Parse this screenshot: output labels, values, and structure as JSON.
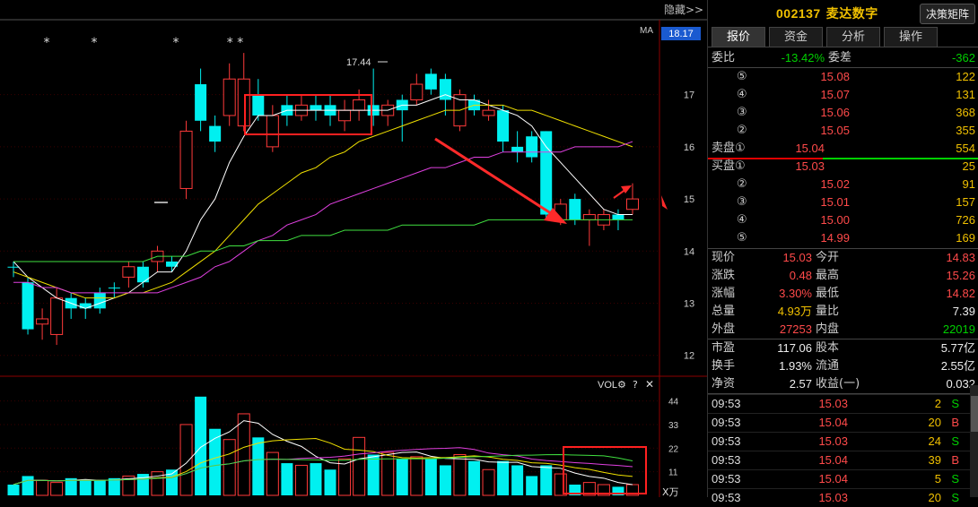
{
  "chart": {
    "hide_label": "隐藏>>",
    "ma_label": "MA",
    "price_tag": "18.17",
    "y_ticks": [
      "17",
      "16",
      "15",
      "14",
      "13",
      "12"
    ],
    "vol_label": "VOL",
    "vol_ticks": [
      "44",
      "33",
      "22",
      "11"
    ],
    "vol_unit": "X万",
    "high_annot": "17.44",
    "stars": [
      "*",
      "*",
      "*",
      "* *"
    ]
  },
  "chart_data": {
    "type": "candlestick",
    "price_ylim": [
      11.6,
      18.3
    ],
    "vol_ylim": [
      0,
      48
    ],
    "candles": [
      {
        "o": 13.7,
        "c": 13.7,
        "h": 13.8,
        "l": 13.5,
        "v": 5,
        "up": false
      },
      {
        "o": 13.4,
        "c": 12.5,
        "h": 13.5,
        "l": 12.4,
        "v": 9,
        "up": false
      },
      {
        "o": 12.6,
        "c": 12.7,
        "h": 12.9,
        "l": 12.3,
        "v": 7,
        "up": true
      },
      {
        "o": 13.1,
        "c": 12.4,
        "h": 13.3,
        "l": 12.2,
        "v": 6,
        "up": true
      },
      {
        "o": 13.1,
        "c": 12.9,
        "h": 13.2,
        "l": 12.7,
        "v": 8,
        "up": false
      },
      {
        "o": 13.0,
        "c": 12.9,
        "h": 13.1,
        "l": 12.7,
        "v": 7,
        "up": false
      },
      {
        "o": 13.2,
        "c": 12.9,
        "h": 13.3,
        "l": 12.8,
        "v": 7,
        "up": false
      },
      {
        "o": 13.3,
        "c": 13.3,
        "h": 13.4,
        "l": 13.1,
        "v": 8,
        "up": false
      },
      {
        "o": 13.5,
        "c": 13.7,
        "h": 13.8,
        "l": 13.3,
        "v": 9,
        "up": true
      },
      {
        "o": 13.7,
        "c": 13.4,
        "h": 13.8,
        "l": 13.3,
        "v": 10,
        "up": false
      },
      {
        "o": 13.8,
        "c": 14.0,
        "h": 14.1,
        "l": 13.6,
        "v": 11,
        "up": true
      },
      {
        "o": 13.8,
        "c": 13.7,
        "h": 13.9,
        "l": 13.6,
        "v": 12,
        "up": false
      },
      {
        "o": 15.2,
        "c": 16.3,
        "h": 16.5,
        "l": 15.0,
        "v": 33,
        "up": true
      },
      {
        "o": 17.2,
        "c": 16.5,
        "h": 17.5,
        "l": 16.3,
        "v": 46,
        "up": false
      },
      {
        "o": 16.4,
        "c": 16.1,
        "h": 16.6,
        "l": 15.9,
        "v": 31,
        "up": false
      },
      {
        "o": 16.6,
        "c": 17.3,
        "h": 17.6,
        "l": 16.4,
        "v": 26,
        "up": true
      },
      {
        "o": 17.3,
        "c": 16.4,
        "h": 17.8,
        "l": 16.3,
        "v": 38,
        "up": true
      },
      {
        "o": 16.6,
        "c": 17.0,
        "h": 17.3,
        "l": 16.5,
        "v": 27,
        "up": false
      },
      {
        "o": 16.6,
        "c": 16.0,
        "h": 16.8,
        "l": 15.9,
        "v": 20,
        "up": true
      },
      {
        "o": 16.6,
        "c": 16.8,
        "h": 17.0,
        "l": 16.4,
        "v": 15,
        "up": false
      },
      {
        "o": 16.8,
        "c": 16.6,
        "h": 17.0,
        "l": 16.5,
        "v": 14,
        "up": true
      },
      {
        "o": 16.7,
        "c": 16.8,
        "h": 17.0,
        "l": 16.5,
        "v": 15,
        "up": false
      },
      {
        "o": 16.8,
        "c": 16.6,
        "h": 17.0,
        "l": 16.4,
        "v": 12,
        "up": false
      },
      {
        "o": 16.5,
        "c": 16.7,
        "h": 16.9,
        "l": 16.3,
        "v": 17,
        "up": true
      },
      {
        "o": 16.7,
        "c": 16.9,
        "h": 17.1,
        "l": 16.5,
        "v": 27,
        "up": true
      },
      {
        "o": 16.8,
        "c": 16.6,
        "h": 17.5,
        "l": 16.4,
        "v": 19,
        "up": false
      },
      {
        "o": 16.8,
        "c": 16.6,
        "h": 16.9,
        "l": 16.4,
        "v": 20,
        "up": true
      },
      {
        "o": 16.7,
        "c": 16.9,
        "h": 17.0,
        "l": 16.1,
        "v": 17,
        "up": false
      },
      {
        "o": 16.9,
        "c": 17.2,
        "h": 17.4,
        "l": 16.8,
        "v": 18,
        "up": true
      },
      {
        "o": 17.4,
        "c": 17.1,
        "h": 17.5,
        "l": 17.0,
        "v": 17,
        "up": false
      },
      {
        "o": 17.3,
        "c": 16.9,
        "h": 17.4,
        "l": 16.6,
        "v": 14,
        "up": false
      },
      {
        "o": 17.0,
        "c": 16.4,
        "h": 17.1,
        "l": 16.3,
        "v": 19,
        "up": true
      },
      {
        "o": 16.7,
        "c": 16.9,
        "h": 17.0,
        "l": 16.6,
        "v": 16,
        "up": false
      },
      {
        "o": 16.7,
        "c": 16.6,
        "h": 16.9,
        "l": 16.5,
        "v": 12,
        "up": true
      },
      {
        "o": 16.7,
        "c": 16.1,
        "h": 16.8,
        "l": 15.9,
        "v": 16,
        "up": false
      },
      {
        "o": 16.0,
        "c": 15.9,
        "h": 16.3,
        "l": 15.7,
        "v": 14,
        "up": false
      },
      {
        "o": 15.8,
        "c": 16.2,
        "h": 16.3,
        "l": 15.7,
        "v": 9,
        "up": false
      },
      {
        "o": 16.3,
        "c": 14.7,
        "h": 16.3,
        "l": 14.6,
        "v": 14,
        "up": false
      },
      {
        "o": 14.9,
        "c": 14.6,
        "h": 15.0,
        "l": 14.5,
        "v": 10,
        "up": true
      },
      {
        "o": 15.0,
        "c": 14.6,
        "h": 15.1,
        "l": 14.5,
        "v": 5,
        "up": false
      },
      {
        "o": 14.6,
        "c": 14.7,
        "h": 14.8,
        "l": 14.1,
        "v": 6,
        "up": true
      },
      {
        "o": 14.5,
        "c": 14.7,
        "h": 14.8,
        "l": 14.4,
        "v": 5,
        "up": true
      },
      {
        "o": 14.7,
        "c": 14.6,
        "h": 14.8,
        "l": 14.4,
        "v": 4,
        "up": false
      },
      {
        "o": 14.8,
        "c": 15.0,
        "h": 15.3,
        "l": 14.7,
        "v": 5,
        "up": true
      }
    ],
    "ma_series": [
      {
        "color": "#ffffff",
        "values": [
          13.8,
          13.5,
          13.3,
          13.1,
          13.0,
          12.9,
          13.0,
          13.1,
          13.2,
          13.4,
          13.6,
          13.6,
          14.0,
          14.6,
          15.0,
          15.7,
          16.2,
          16.6,
          16.6,
          16.7,
          16.7,
          16.7,
          16.7,
          16.7,
          16.7,
          16.7,
          16.7,
          16.8,
          16.8,
          16.9,
          17.0,
          16.9,
          16.9,
          16.8,
          16.7,
          16.6,
          16.4,
          16.0,
          15.7,
          15.4,
          15.1,
          14.8,
          14.7,
          14.7
        ]
      },
      {
        "color": "#f0e000",
        "values": [
          13.6,
          13.5,
          13.4,
          13.3,
          13.2,
          13.1,
          13.1,
          13.1,
          13.2,
          13.2,
          13.3,
          13.4,
          13.6,
          13.8,
          14.0,
          14.3,
          14.6,
          14.9,
          15.1,
          15.3,
          15.5,
          15.6,
          15.8,
          15.9,
          16.1,
          16.2,
          16.3,
          16.4,
          16.5,
          16.6,
          16.7,
          16.7,
          16.8,
          16.8,
          16.8,
          16.7,
          16.7,
          16.6,
          16.5,
          16.4,
          16.3,
          16.2,
          16.1,
          16.0
        ]
      },
      {
        "color": "#e040e0",
        "values": [
          13.4,
          13.4,
          13.3,
          13.3,
          13.2,
          13.2,
          13.2,
          13.2,
          13.2,
          13.2,
          13.2,
          13.3,
          13.4,
          13.5,
          13.7,
          13.8,
          14.0,
          14.2,
          14.3,
          14.5,
          14.6,
          14.7,
          14.9,
          15.0,
          15.1,
          15.2,
          15.3,
          15.4,
          15.5,
          15.6,
          15.6,
          15.7,
          15.8,
          15.8,
          15.9,
          15.9,
          15.9,
          15.9,
          15.9,
          16.0,
          16.0,
          16.0,
          16.0,
          16.1
        ]
      },
      {
        "color": "#40e040",
        "values": [
          13.8,
          13.8,
          13.8,
          13.8,
          13.8,
          13.8,
          13.8,
          13.8,
          13.8,
          13.8,
          13.9,
          13.9,
          13.9,
          14.0,
          14.0,
          14.1,
          14.1,
          14.2,
          14.2,
          14.2,
          14.3,
          14.3,
          14.3,
          14.4,
          14.4,
          14.4,
          14.4,
          14.5,
          14.5,
          14.5,
          14.5,
          14.5,
          14.5,
          14.6,
          14.6,
          14.6,
          14.6,
          14.6,
          14.6,
          14.6,
          14.6,
          14.6,
          14.6,
          14.6
        ]
      }
    ]
  },
  "side": {
    "code": "002137",
    "name": "麦达数字",
    "matrix_btn": "决策矩阵",
    "tabs": [
      "报价",
      "资金",
      "分析",
      "操作"
    ],
    "weibi_label": "委比",
    "weibi_val": "-13.42%",
    "weicha_label": "委差",
    "weicha_val": "-362",
    "asks": [
      {
        "label": "⑤",
        "price": "15.08",
        "vol": "122"
      },
      {
        "label": "④",
        "price": "15.07",
        "vol": "131"
      },
      {
        "label": "③",
        "price": "15.06",
        "vol": "368"
      },
      {
        "label": "②",
        "price": "15.05",
        "vol": "355"
      },
      {
        "label": "卖盘①",
        "price": "15.04",
        "vol": "554"
      }
    ],
    "bids": [
      {
        "label": "买盘①",
        "price": "15.03",
        "vol": "25"
      },
      {
        "label": "②",
        "price": "15.02",
        "vol": "91"
      },
      {
        "label": "③",
        "price": "15.01",
        "vol": "157"
      },
      {
        "label": "④",
        "price": "15.00",
        "vol": "726"
      },
      {
        "label": "⑤",
        "price": "14.99",
        "vol": "169"
      }
    ],
    "stats": [
      {
        "a": "现价",
        "b": "15.03",
        "bc": "red",
        "c": "今开",
        "d": "14.83",
        "dc": "red"
      },
      {
        "a": "涨跌",
        "b": "0.48",
        "bc": "red",
        "c": "最高",
        "d": "15.26",
        "dc": "red"
      },
      {
        "a": "涨幅",
        "b": "3.30%",
        "bc": "red",
        "c": "最低",
        "d": "14.82",
        "dc": "red"
      },
      {
        "a": "总量",
        "b": "4.93万",
        "bc": "yellow",
        "c": "量比",
        "d": "7.39",
        "dc": "white"
      },
      {
        "a": "外盘",
        "b": "27253",
        "bc": "red",
        "c": "内盘",
        "d": "22019",
        "dc": "green"
      }
    ],
    "stats2": [
      {
        "a": "市盈",
        "b": "117.06",
        "c": "股本",
        "d": "5.77亿"
      },
      {
        "a": "换手",
        "b": "1.93%",
        "c": "流通",
        "d": "2.55亿"
      },
      {
        "a": "净资",
        "b": "2.57",
        "c": "收益(一)",
        "d": "0.032"
      }
    ],
    "ticks": [
      {
        "t": "09:53",
        "p": "15.03",
        "v": "2",
        "bs": "S"
      },
      {
        "t": "09:53",
        "p": "15.04",
        "v": "20",
        "bs": "B"
      },
      {
        "t": "09:53",
        "p": "15.03",
        "v": "24",
        "bs": "S"
      },
      {
        "t": "09:53",
        "p": "15.04",
        "v": "39",
        "bs": "B"
      },
      {
        "t": "09:53",
        "p": "15.04",
        "v": "5",
        "bs": "S"
      },
      {
        "t": "09:53",
        "p": "15.03",
        "v": "20",
        "bs": "S"
      }
    ]
  }
}
